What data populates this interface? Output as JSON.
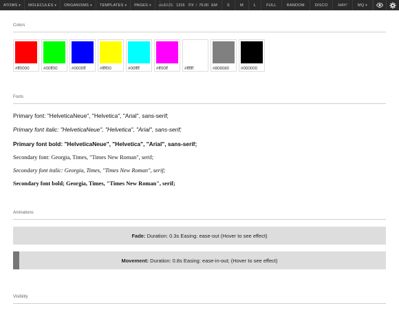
{
  "topbar": {
    "left": [
      {
        "label": "ATOMS",
        "caret": true
      },
      {
        "label": "MOLECULES",
        "caret": true
      },
      {
        "label": "ORGANISMS",
        "caret": true
      },
      {
        "label": "TEMPLATES",
        "caret": true
      },
      {
        "label": "PAGES",
        "caret": true
      },
      {
        "label": "ALL",
        "caret": false
      }
    ],
    "size_label": "SIZE",
    "size_px": "1216",
    "size_px_unit": "PX",
    "size_em": "76.00",
    "size_em_unit": "EM",
    "right": [
      "S",
      "M",
      "L",
      "FULL",
      "RANDOM",
      "DISCO",
      "HAY!"
    ],
    "mq_label": "MQ",
    "icons": [
      "eye-icon",
      "gear-icon"
    ]
  },
  "colors": {
    "title": "Colors",
    "swatches": [
      {
        "hex": "#ff0000"
      },
      {
        "hex": "#00ff00"
      },
      {
        "hex": "#0000ff"
      },
      {
        "hex": "#ffff00"
      },
      {
        "hex": "#00ffff"
      },
      {
        "hex": "#ff00ff"
      },
      {
        "hex": "#ffffff"
      },
      {
        "hex": "#808080"
      },
      {
        "hex": "#000000"
      }
    ]
  },
  "fonts": {
    "title": "Fonts",
    "lines": [
      "Primary font: \"HelveticaNeue\", \"Helvetica\", \"Arial\", sans-serif;",
      "Primary font italic: \"HelveticaNeue\", \"Helvetica\", \"Arial\", sans-serif;",
      "Primary font bold: \"HelveticaNeue\", \"Helvetica\", \"Arial\", sans-serif;",
      "Secondary font: Georgia, Times, \"Times New Roman\", serif;",
      "Secondary font italic: Georgia, Times, \"Times New Roman\", serif;",
      "Secondary font bold; Georgia, Times, \"Times New Roman\", serif;"
    ]
  },
  "animations": {
    "title": "Animations",
    "fade_label": "Fade:",
    "fade_text": " Duration: 0.3s Easing: ease-out (Hover to see effect)",
    "move_label": "Movement:",
    "move_text": " Duration: 0.8s Easing: ease-in-out; (Hover to see effect)"
  },
  "visibility": {
    "title": "Visibility"
  }
}
